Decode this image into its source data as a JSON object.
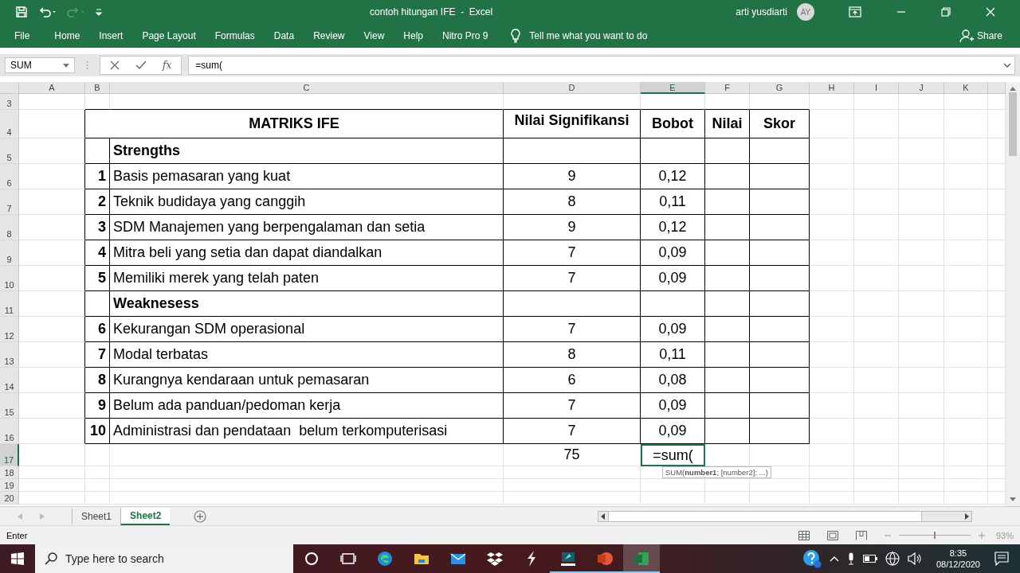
{
  "window": {
    "title": "contoh hitungan IFE  -  Excel",
    "user": "arti yusdiarti",
    "avatar": "AY"
  },
  "ribbon_tabs": [
    {
      "label": "File"
    },
    {
      "label": "Home"
    },
    {
      "label": "Insert"
    },
    {
      "label": "Page Layout"
    },
    {
      "label": "Formulas"
    },
    {
      "label": "Data"
    },
    {
      "label": "Review"
    },
    {
      "label": "View"
    },
    {
      "label": "Help"
    },
    {
      "label": "Nitro Pro 9"
    }
  ],
  "tell_me": "Tell me what you want to do",
  "share": "Share",
  "formula_bar": {
    "name_box": "SUM",
    "fx": "fx",
    "formula": "=sum("
  },
  "sheet": {
    "columns": [
      {
        "label": "A",
        "selected": false
      },
      {
        "label": "B",
        "selected": false
      },
      {
        "label": "C",
        "selected": false
      },
      {
        "label": "D",
        "selected": false
      },
      {
        "label": "E",
        "selected": true
      },
      {
        "label": "F",
        "selected": false
      },
      {
        "label": "G",
        "selected": false
      },
      {
        "label": "H",
        "selected": false
      },
      {
        "label": "I",
        "selected": false
      },
      {
        "label": "J",
        "selected": false
      },
      {
        "label": "K",
        "selected": false
      }
    ],
    "rows": [
      {
        "number": "3",
        "selected": false
      },
      {
        "number": "4",
        "selected": false
      },
      {
        "number": "5",
        "selected": false
      },
      {
        "number": "6",
        "selected": false
      },
      {
        "number": "7",
        "selected": false
      },
      {
        "number": "8",
        "selected": false
      },
      {
        "number": "9",
        "selected": false
      },
      {
        "number": "10",
        "selected": false
      },
      {
        "number": "11",
        "selected": false
      },
      {
        "number": "12",
        "selected": false
      },
      {
        "number": "13",
        "selected": false
      },
      {
        "number": "14",
        "selected": false
      },
      {
        "number": "15",
        "selected": false
      },
      {
        "number": "16",
        "selected": false
      },
      {
        "number": "17",
        "selected": true
      },
      {
        "number": "18",
        "selected": false
      },
      {
        "number": "19",
        "selected": false
      },
      {
        "number": "20",
        "selected": false
      }
    ],
    "matrix": {
      "title": "MATRIKS IFE",
      "headers": [
        "Nilai Signifikansi",
        "Bobot",
        "Nilai",
        "Skor"
      ],
      "entries": [
        {
          "kind": "section",
          "label": "Strengths"
        },
        {
          "kind": "item",
          "number": "1",
          "factor": "Basis pemasaran yang kuat",
          "nilai": "9",
          "bobot": "0,12"
        },
        {
          "kind": "item",
          "number": "2",
          "factor": "Teknik budidaya yang canggih",
          "nilai": "8",
          "bobot": "0,11"
        },
        {
          "kind": "item",
          "number": "3",
          "factor": "SDM Manajemen yang berpengalaman dan setia",
          "nilai": "9",
          "bobot": "0,12"
        },
        {
          "kind": "item",
          "number": "4",
          "factor": "Mitra beli yang setia dan dapat diandalkan",
          "nilai": "7",
          "bobot": "0,09"
        },
        {
          "kind": "item",
          "number": "5",
          "factor": "Memiliki merek yang telah paten",
          "nilai": "7",
          "bobot": "0,09"
        },
        {
          "kind": "section",
          "label": "Weaknesess"
        },
        {
          "kind": "item",
          "number": "6",
          "factor": "Kekurangan SDM operasional",
          "nilai": "7",
          "bobot": "0,09"
        },
        {
          "kind": "item",
          "number": "7",
          "factor": "Modal terbatas",
          "nilai": "8",
          "bobot": "0,11"
        },
        {
          "kind": "item",
          "number": "8",
          "factor": "Kurangnya kendaraan untuk pemasaran",
          "nilai": "6",
          "bobot": "0,08"
        },
        {
          "kind": "item",
          "number": "9",
          "factor": "Belum ada panduan/pedoman kerja",
          "nilai": "7",
          "bobot": "0,09"
        },
        {
          "kind": "item",
          "number": "10",
          "factor": "Administrasi dan pendataan  belum terkomputerisasi",
          "nilai": "7",
          "bobot": "0,09"
        }
      ],
      "total": {
        "nilai": "75",
        "bobot": "=sum(",
        "selected": true
      }
    },
    "tooltip": "SUM(**number1**; [number2]; ...)"
  },
  "sheet_tabs": [
    {
      "label": "Sheet1",
      "selected": false
    },
    {
      "label": "Sheet2",
      "selected": true
    }
  ],
  "status_bar": {
    "mode": "Enter",
    "zoom": "93%",
    "zoom_slider": {
      "level": 0.5
    }
  },
  "taskbar": {
    "placeholder": "Type here to search",
    "time": "8:35",
    "date": "08/12/2020"
  }
}
